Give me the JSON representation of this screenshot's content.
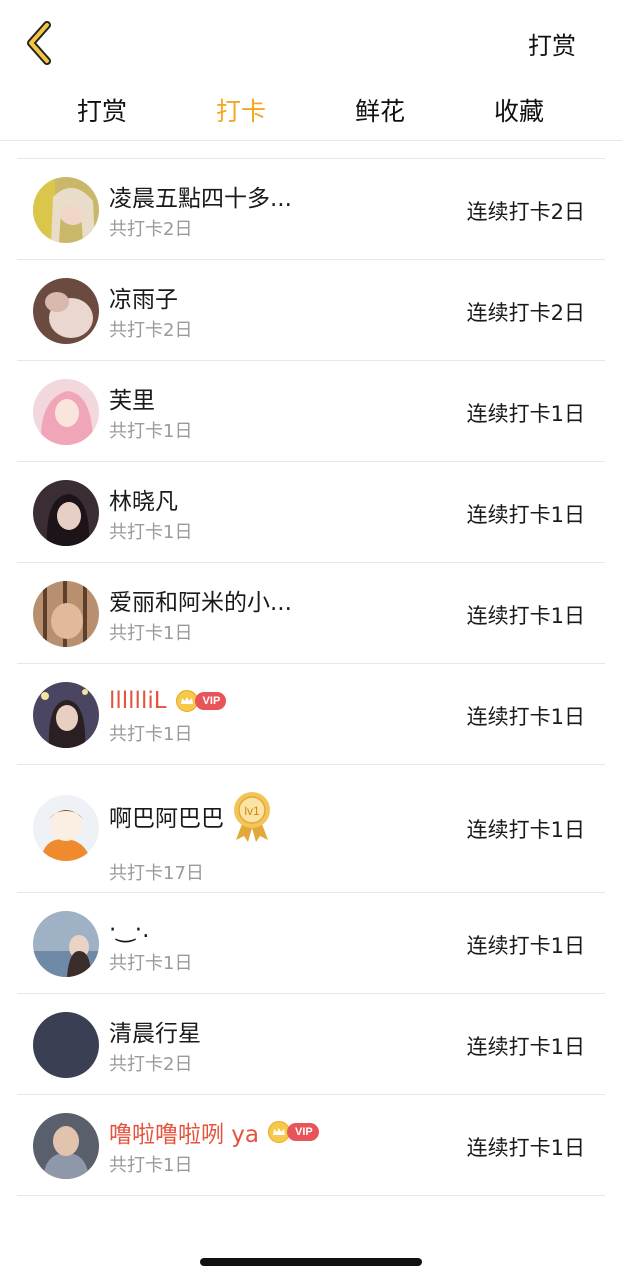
{
  "header": {
    "action_label": "打赏",
    "back_icon": "chevron-left-icon",
    "accent_color": "#f5a623"
  },
  "tabs": [
    {
      "label": "打赏",
      "active": false
    },
    {
      "label": "打卡",
      "active": true
    },
    {
      "label": "鲜花",
      "active": false
    },
    {
      "label": "收藏",
      "active": false
    }
  ],
  "list": [
    {
      "name": "凌晨五點四十多...",
      "sub": "共打卡2日",
      "streak": "连续打卡2日",
      "vip": false
    },
    {
      "name": "凉雨子",
      "sub": "共打卡2日",
      "streak": "连续打卡2日",
      "vip": false
    },
    {
      "name": "芙里",
      "sub": "共打卡1日",
      "streak": "连续打卡1日",
      "vip": false
    },
    {
      "name": "林晓凡",
      "sub": "共打卡1日",
      "streak": "连续打卡1日",
      "vip": false
    },
    {
      "name": "爱丽和阿米的小...",
      "sub": "共打卡1日",
      "streak": "连续打卡1日",
      "vip": false
    },
    {
      "name": "lllllliL",
      "sub": "共打卡1日",
      "streak": "连续打卡1日",
      "vip": true,
      "badge": "VIP"
    },
    {
      "name": "啊巴阿巴巴",
      "sub": "共打卡17日",
      "streak": "连续打卡1日",
      "vip": false,
      "level_badge": "lv1"
    },
    {
      "name": "·‿·.",
      "sub": "共打卡1日",
      "streak": "连续打卡1日",
      "vip": false
    },
    {
      "name": "清晨行星",
      "sub": "共打卡2日",
      "streak": "连续打卡1日",
      "vip": false
    },
    {
      "name": "噜啦噜啦咧 ya",
      "sub": "共打卡1日",
      "streak": "连续打卡1日",
      "vip": true,
      "badge": "VIP"
    }
  ]
}
